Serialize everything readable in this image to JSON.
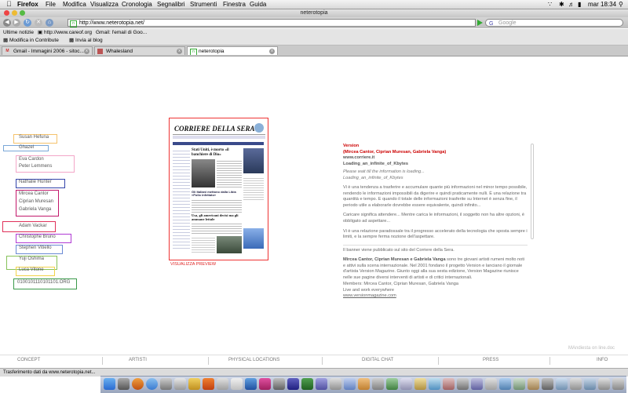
{
  "menubar": {
    "app": "Firefox",
    "items": [
      "File",
      "Modifica",
      "Visualizza",
      "Cronologia",
      "Segnalibri",
      "Strumenti",
      "Finestra",
      "Guida"
    ],
    "clock": "mar 18:34"
  },
  "window": {
    "title": "neterotopia"
  },
  "toolbar": {
    "url": "http://www.neterotopia.net/",
    "search_placeholder": "Google"
  },
  "bookmarks": {
    "row1": [
      "Ultime notizie",
      "http://www.careof.org",
      "Gmail: l'email di Goo..."
    ],
    "row2": [
      "Modifica in Contribute",
      "Invia al blog"
    ]
  },
  "tabs": [
    {
      "label": "Gmail - Immagini 2006 - sitoc...",
      "active": false
    },
    {
      "label": "Whalesland",
      "active": false
    },
    {
      "label": "neterotopia",
      "active": true
    }
  ],
  "names": [
    "Susan Hefuna",
    "Ghazel",
    "Eva Cardon",
    "Peter Lemmens",
    "Nathalie Hunter",
    "Mircea Cantor",
    "Ciprian Muresan",
    "Gabriela Vanga",
    "Adam Vackar",
    "Christophe Bruno",
    "Stephen Vitiello",
    "Yuji Oshima",
    "Luca Vitone",
    "0100101110101101.ORG"
  ],
  "preview": {
    "masthead": "CORRIERE DELLA SERA",
    "headline1": "Stati Uniti, è morto «il banchiere di Dio»",
    "headline2": "Gli Italiani mettono dalla Libia «Pollo infettato»",
    "headline3": "Usa, gli americani decisi ma gli ammane lettale",
    "caption": "VISUALIZZA PREVIEW"
  },
  "info": {
    "title": "Version",
    "artists": "(Mircea Cantor, Ciprian Muresan, Gabriela Vanga)",
    "site": "www.corriere.it",
    "loading": "Loading_an_infinite_of_Kbytes",
    "wait1": "Please wait till the information is loading...",
    "wait2": "Loading_an_infinite_of_Kbytes",
    "p1": "Vi è una tendenza a trasferire e accumulare quante più informazioni nel minor tempo possibile, rendendo le informazioni impossibili da digerire e quindi praticamente nulli. È una relazione tra quantità e tempo. E quando il totale delle informazioni trasferite su Internet è senza fine, il periodo utile a elaborarle dovrebbe essere equivalente, quindi infinito...",
    "p2": "Caricare significa attendere... Mentre carica le informazioni, il soggetto non ha altre opzioni, è obbligato ad aspettare...",
    "p3": "Vi è una relazione paradossale tra il progresso accelerato della tecnologia che sposta sempre i limiti, e la sempre ferma nozione dell'aspettare.",
    "p4": "Il banner viene pubblicato sul sito del Corriere della Sera.",
    "p5_bold": "Mircea Cantor, Ciprian Muresan e Gabriela Vanga",
    "p5": " sono tre giovani artisti rumeni molto noti e attivi sulla scena internazionale. Nel 2001 fondano il progetto Version e lanciano il giornale d'artista Version Magazine. Giunto oggi alla sua sesta edizione, Version Magazine riunisce nelle sue pagine diversi interventi di artisti e di critici internazionali.",
    "members": "Members: Mircea Cantor, Ciprian Muresan, Gabriela Vanga",
    "live": "Live and work everywhere",
    "link": "www.versionmagazine.com"
  },
  "watermark": "MAndiesta on line.doc",
  "bottom_nav": [
    "CONCEPT",
    "ARTISTI",
    "PHYSICAL LOCATIONS",
    "DIGITAL CHAT",
    "PRESS",
    "INFO"
  ],
  "status": "Trasferimento dati da www.neterotopia.net..."
}
